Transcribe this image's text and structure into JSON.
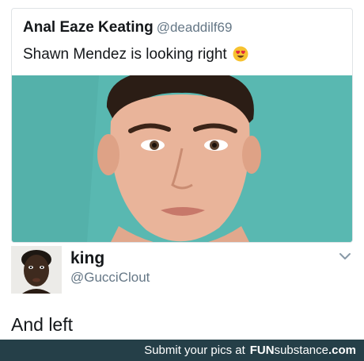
{
  "quoted_tweet": {
    "name": "Anal Eaze Keating",
    "handle": "@deaddilf69",
    "text": "Shawn Mendez is looking right",
    "emoji_icon": "heart-eyes-emoji"
  },
  "reply_tweet": {
    "name": "king",
    "handle": "@GucciClout",
    "text": "And left",
    "menu_icon": "chevron-down-icon"
  },
  "footer": {
    "prompt": "Submit your pics at",
    "brand_part1": "FUN",
    "brand_part2": "substance",
    "brand_part3": ".com"
  },
  "colors": {
    "photo_background": "#59b8b1",
    "footer_background": "#253f48",
    "handle_gray": "#657786"
  }
}
